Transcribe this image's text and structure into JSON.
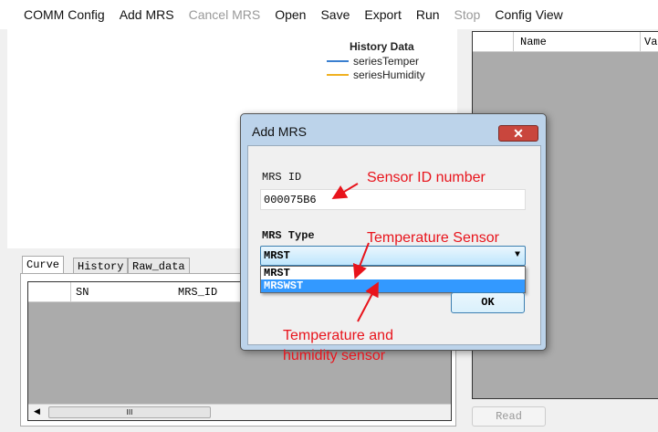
{
  "menu": [
    {
      "label": "COMM Config",
      "enabled": true
    },
    {
      "label": "Add MRS",
      "enabled": true
    },
    {
      "label": "Cancel MRS",
      "enabled": false
    },
    {
      "label": "Open",
      "enabled": true
    },
    {
      "label": "Save",
      "enabled": true
    },
    {
      "label": "Export",
      "enabled": true
    },
    {
      "label": "Run",
      "enabled": true
    },
    {
      "label": "Stop",
      "enabled": false
    },
    {
      "label": "Config View",
      "enabled": true
    }
  ],
  "chart": {
    "title": "History Data",
    "series": [
      {
        "name": "seriesTemper",
        "color": "#3a7fd0"
      },
      {
        "name": "seriesHumidity",
        "color": "#f0b020"
      }
    ]
  },
  "tabs": [
    "Curve",
    "History",
    "Raw_data"
  ],
  "left_grid": {
    "columns": [
      "SN",
      "MRS_ID"
    ],
    "scroll_thumb": "III"
  },
  "right_grid": {
    "columns": [
      "Name",
      "Va"
    ]
  },
  "read_button": "Read",
  "dialog": {
    "title": "Add MRS",
    "close": "✕",
    "id_label": "MRS ID",
    "id_value": "000075B6",
    "type_label": "MRS Type",
    "type_value": "MRST",
    "options": [
      "MRST",
      "MRSWST"
    ],
    "selected_option": "MRSWST",
    "ok": "OK"
  },
  "annotations": {
    "id": "Sensor ID number",
    "temp": "Temperature Sensor",
    "humid1": "Temperature and",
    "humid2": "humidity sensor"
  }
}
